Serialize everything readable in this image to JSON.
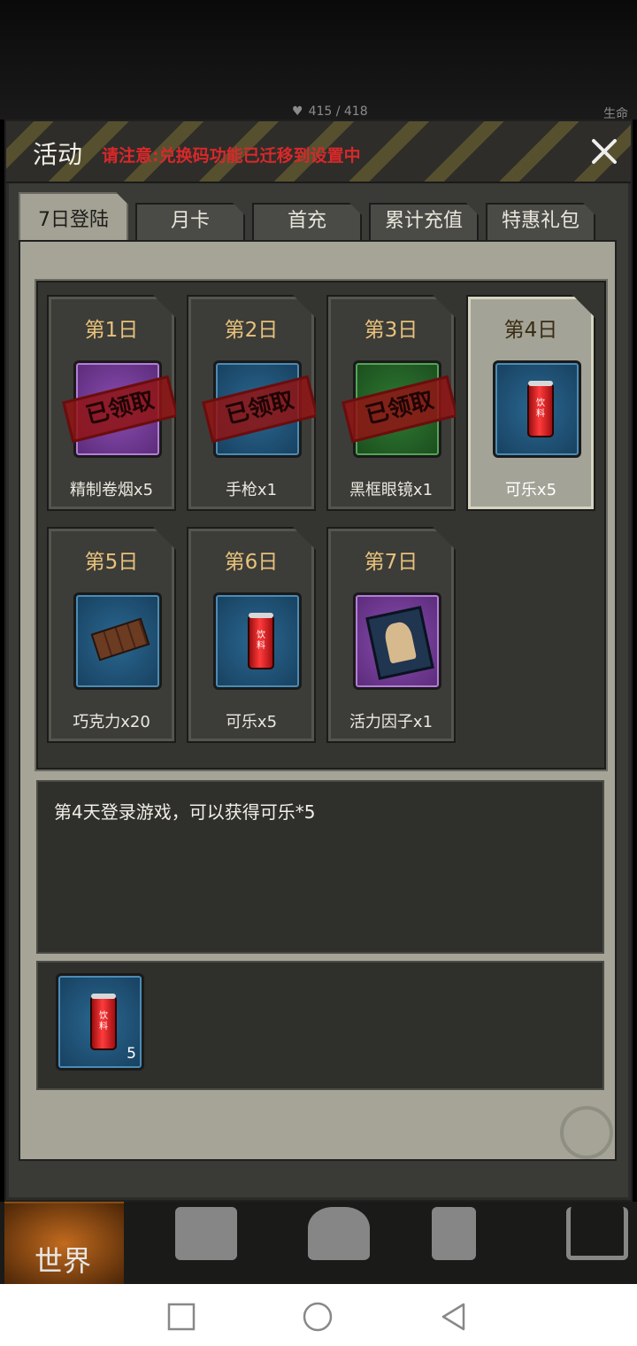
{
  "status": {
    "hp": "415 / 418",
    "hp_label": "生命"
  },
  "header": {
    "title": "活动",
    "notice": "请注意:兑换码功能已迁移到设置中"
  },
  "tabs": [
    {
      "label": "7日登陆",
      "active": true
    },
    {
      "label": "月卡",
      "active": false
    },
    {
      "label": "首充",
      "active": false
    },
    {
      "label": "累计充值",
      "active": false
    },
    {
      "label": "特惠礼包",
      "active": false
    }
  ],
  "days": [
    {
      "day": "第1日",
      "name": "精制卷烟x5",
      "claimed": true,
      "claimed_label": "已领取",
      "icon": "cigarette-icon",
      "frame": "purple"
    },
    {
      "day": "第2日",
      "name": "手枪x1",
      "claimed": true,
      "claimed_label": "已领取",
      "icon": "pistol-icon",
      "frame": "blue"
    },
    {
      "day": "第3日",
      "name": "黑框眼镜x1",
      "claimed": true,
      "claimed_label": "已领取",
      "icon": "glasses-icon",
      "frame": "green"
    },
    {
      "day": "第4日",
      "name": "可乐x5",
      "claimed": false,
      "selected": true,
      "icon": "cola-can-icon",
      "frame": "blue"
    },
    {
      "day": "第5日",
      "name": "巧克力x20",
      "claimed": false,
      "icon": "chocolate-icon",
      "frame": "blue"
    },
    {
      "day": "第6日",
      "name": "可乐x5",
      "claimed": false,
      "icon": "cola-can-icon",
      "frame": "blue"
    },
    {
      "day": "第7日",
      "name": "活力因子x1",
      "claimed": false,
      "icon": "vitality-book-icon",
      "frame": "purple"
    }
  ],
  "can_label": "饮料",
  "description": "第4天登录游戏，可以获得可乐*5",
  "reward": {
    "quantity": "5",
    "icon": "cola-can-icon"
  },
  "bottom_nav": {
    "world_label": "世界",
    "items": [
      "backpack-icon",
      "skills-head-icon",
      "phone-icon",
      "shop-cart-icon"
    ]
  },
  "colors": {
    "notice": "#d8282a",
    "day_label": "#e8c27a",
    "accent_panel": "#a5a497"
  }
}
